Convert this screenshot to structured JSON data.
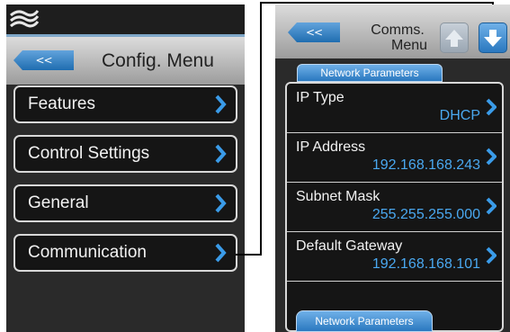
{
  "left_screen": {
    "logo_icon": "wave-logo",
    "back_label": "<<",
    "title": "Config. Menu",
    "items": [
      {
        "label": "Features"
      },
      {
        "label": "Control Settings"
      },
      {
        "label": "General"
      },
      {
        "label": "Communication"
      }
    ]
  },
  "right_screen": {
    "back_label": "<<",
    "title_line1": "Comms.",
    "title_line2": "Menu",
    "up_icon": "arrow-up-icon",
    "down_icon": "arrow-down-icon",
    "tab_label": "Network Parameters",
    "rows": [
      {
        "label": "IP Type",
        "value": "DHCP"
      },
      {
        "label": "IP Address",
        "value": "192.168.168.243"
      },
      {
        "label": "Subnet Mask",
        "value": "255.255.255.000"
      },
      {
        "label": "Default Gateway",
        "value": "192.168.168.101"
      }
    ],
    "bottom_button": "Network Parameters"
  },
  "colors": {
    "accent_blue": "#2a78bf",
    "value_blue": "#4aa8f0",
    "panel_bg": "#151515",
    "screen_bg": "#2a2a2a"
  }
}
